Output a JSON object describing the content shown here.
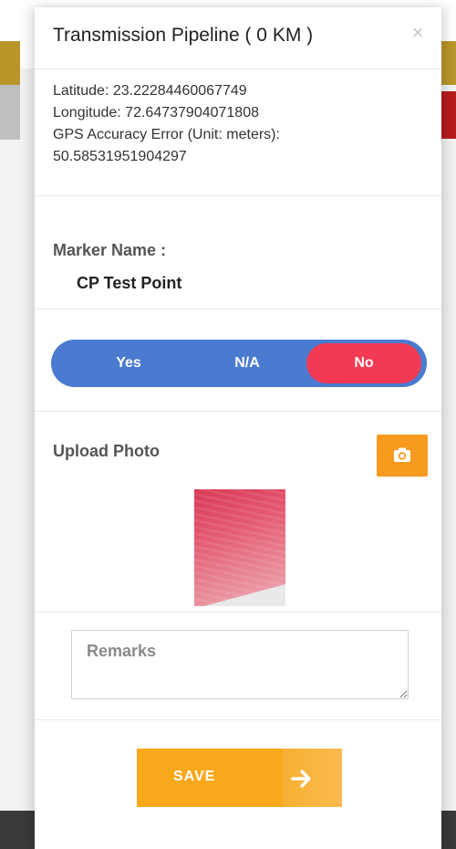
{
  "modal": {
    "title": "Transmission Pipeline ( 0 KM )",
    "close_symbol": "×"
  },
  "gps": {
    "latitude": "Latitude: 23.22284460067749",
    "longitude": "Longitude: 72.64737904071808",
    "accuracy_label": "GPS Accuracy Error (Unit: meters):",
    "accuracy_value": "50.58531951904297"
  },
  "marker": {
    "label": "Marker Name :",
    "value": "CP Test Point"
  },
  "toggle": {
    "options": [
      "Yes",
      "N/A",
      "No"
    ],
    "selected": "No"
  },
  "upload": {
    "label": "Upload Photo",
    "camera_icon": "camera-icon"
  },
  "remarks": {
    "placeholder": "Remarks"
  },
  "save": {
    "label": "SAVE",
    "icon": "arrow-right-icon"
  },
  "colors": {
    "toggle_bg": "#4a7bd0",
    "toggle_selected": "#f23a54",
    "accent_orange": "#f79a1e",
    "save_bg": "#f8a81b"
  }
}
